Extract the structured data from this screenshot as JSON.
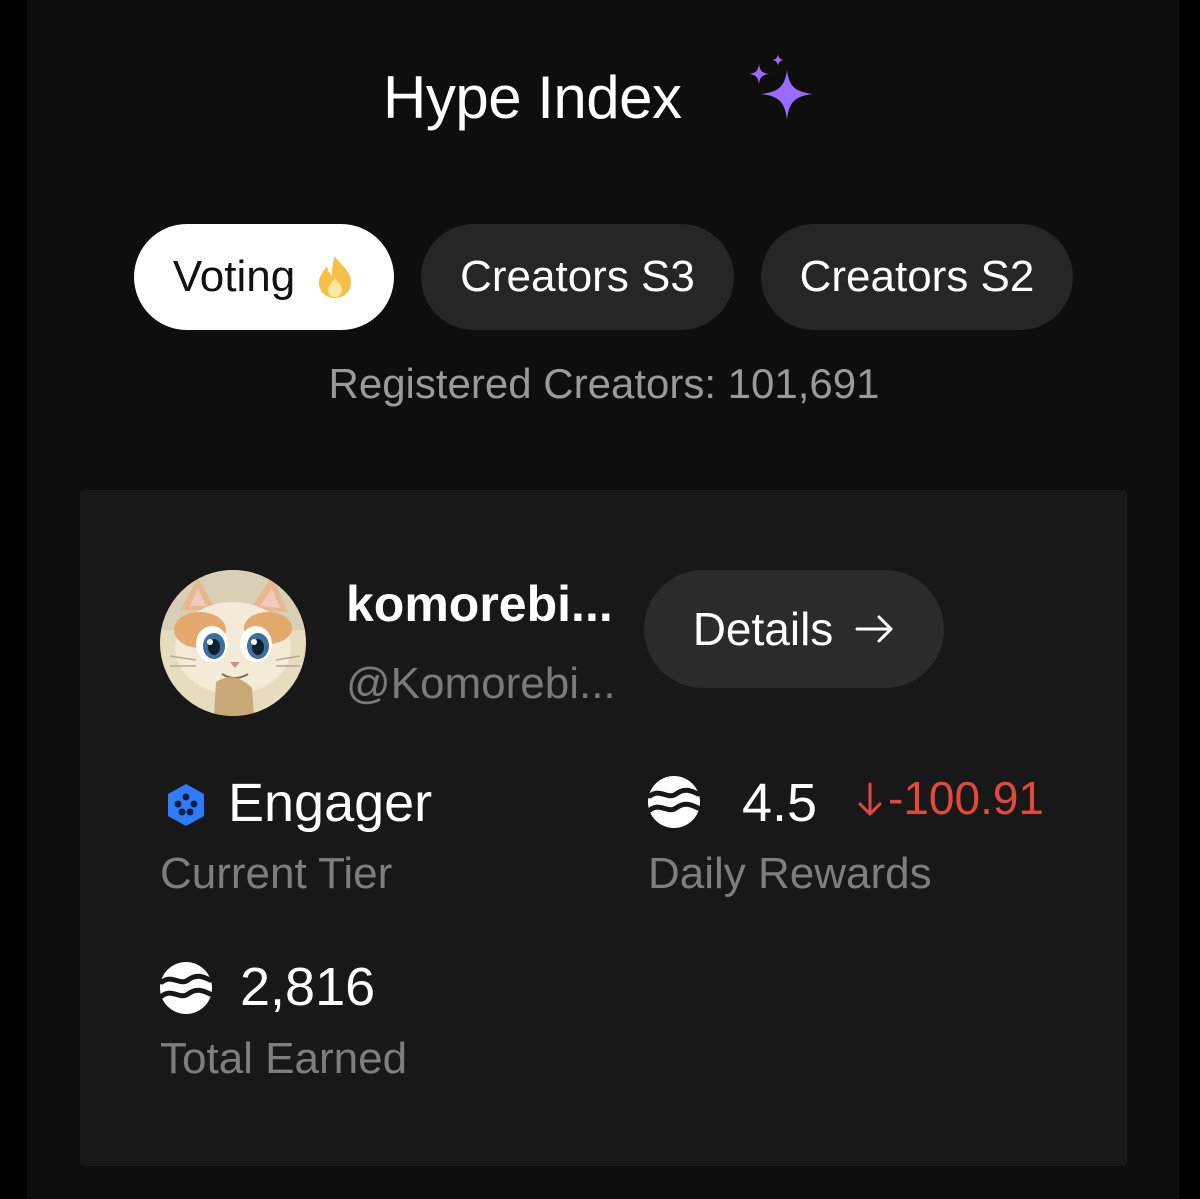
{
  "header": {
    "title": "Hype Index",
    "title_icon": "sparkles-icon"
  },
  "tabs": [
    {
      "label": "Voting",
      "icon": "fire-icon",
      "active": true
    },
    {
      "label": "Creators S3",
      "active": false
    },
    {
      "label": "Creators S2",
      "active": false
    }
  ],
  "registered_creators": "Registered Creators: 101,691",
  "profile": {
    "name": "komorebi...",
    "handle": "@Komorebi...",
    "avatar": "cat-avatar",
    "details_label": "Details",
    "details_icon": "arrow-right-icon"
  },
  "stats": {
    "tier": {
      "value": "Engager",
      "label": "Current Tier",
      "icon": "tier-hexagon-icon"
    },
    "daily_rewards": {
      "value": "4.5",
      "change": "-100.91",
      "change_icon": "arrow-down-icon",
      "label": "Daily Rewards",
      "icon": "coin-icon"
    },
    "total_earned": {
      "value": "2,816",
      "label": "Total Earned",
      "icon": "coin-icon"
    }
  },
  "colors": {
    "background": "#0e0e0e",
    "card": "#181818",
    "tab_inactive": "#262626",
    "tab_active": "#ffffff",
    "accent_purple": "#9b6bff",
    "negative": "#e04a3b",
    "tier_blue": "#2f7cf6",
    "fire_yellow": "#f5c04a"
  }
}
